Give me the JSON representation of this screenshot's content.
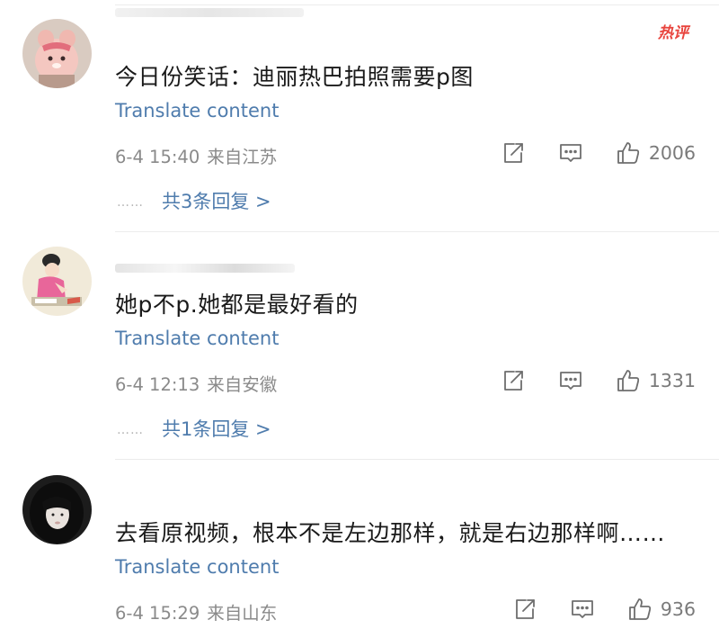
{
  "comments": [
    {
      "text": "今日份笑话：迪丽热巴拍照需要p图",
      "translate": "Translate content",
      "date": "6-4 15:40",
      "location": "来自江苏",
      "likes": "2006",
      "replies": "共3条回复 >",
      "badge": "热评"
    },
    {
      "text": "她p不p.她都是最好看的",
      "translate": "Translate content",
      "date": "6-4 12:13",
      "location": "来自安徽",
      "likes": "1331",
      "replies": "共1条回复 >"
    },
    {
      "text": "去看原视频，根本不是左边那样，就是右边那样啊……",
      "translate": "Translate content",
      "date": "6-4 15:29",
      "location": "来自山东",
      "likes": "936"
    }
  ],
  "replies_dots": "……",
  "colors": {
    "link": "#4f7cad",
    "meta": "#8a8a8a",
    "hot_badge": "#e8443d",
    "divider": "#ececec"
  },
  "icons": {
    "share": "share-icon",
    "reply": "comment-icon",
    "like": "thumbs-up-icon",
    "avatar1": "avatar-pink-bear",
    "avatar2": "avatar-painting-lady",
    "avatar3": "avatar-dark-hair-girl"
  }
}
